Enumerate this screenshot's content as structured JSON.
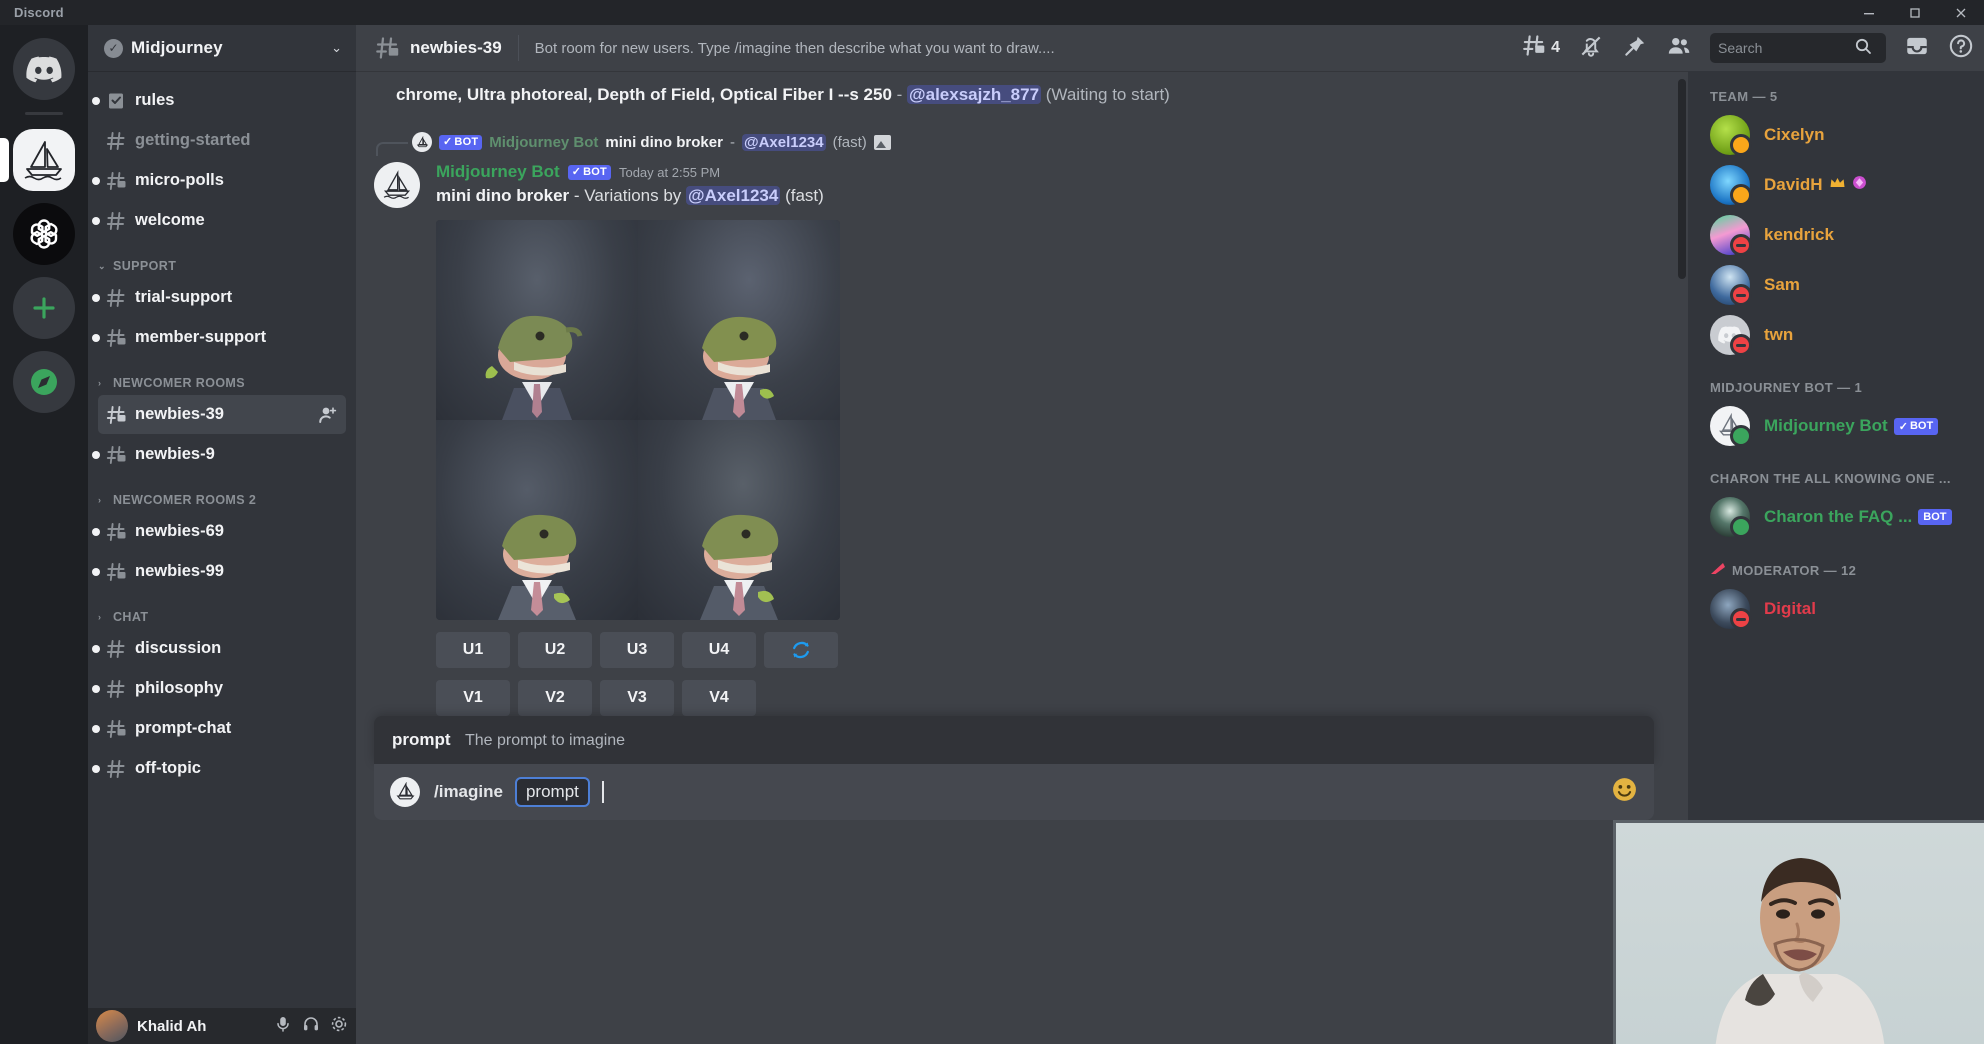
{
  "titlebar": {
    "app_name": "Discord",
    "minimize": "minimize-icon",
    "maximize": "maximize-icon",
    "close": "close-icon"
  },
  "server_rail": {
    "items": [
      {
        "name": "Direct Messages",
        "icon": "discord-logo-icon",
        "selected": false
      },
      {
        "name": "Midjourney",
        "icon": "sailboat-icon",
        "selected": true
      },
      {
        "name": "OpenAI",
        "icon": "openai-logo-icon",
        "selected": false
      },
      {
        "name": "Add a Server",
        "icon": "plus-icon",
        "selected": false
      },
      {
        "name": "Explore Public Servers",
        "icon": "compass-icon",
        "selected": false
      }
    ]
  },
  "sidebar": {
    "guild_name": "Midjourney",
    "verified_badge": "✓",
    "chevron": "⌄",
    "groups": [
      {
        "label": "",
        "channels": [
          {
            "name": "rules",
            "icon": "rules-icon",
            "muted": false,
            "unread": true,
            "active": false
          },
          {
            "name": "getting-started",
            "icon": "hash-icon",
            "muted": true,
            "unread": false,
            "active": false
          },
          {
            "name": "micro-polls",
            "icon": "hash-thread-icon",
            "muted": false,
            "unread": true,
            "active": false
          },
          {
            "name": "welcome",
            "icon": "hash-icon",
            "muted": false,
            "unread": true,
            "active": false
          }
        ]
      },
      {
        "label": "SUPPORT",
        "caret": "⌄",
        "channels": [
          {
            "name": "trial-support",
            "icon": "hash-icon",
            "muted": false,
            "unread": true,
            "active": false
          },
          {
            "name": "member-support",
            "icon": "hash-thread-icon",
            "muted": false,
            "unread": true,
            "active": false
          }
        ]
      },
      {
        "label": "NEWCOMER ROOMS",
        "caret": "›",
        "channels": [
          {
            "name": "newbies-39",
            "icon": "hash-thread-icon",
            "muted": false,
            "unread": false,
            "active": true,
            "trailing": "add-member-icon"
          },
          {
            "name": "newbies-9",
            "icon": "hash-thread-icon",
            "muted": false,
            "unread": true,
            "active": false
          }
        ]
      },
      {
        "label": "NEWCOMER ROOMS 2",
        "caret": "›",
        "channels": [
          {
            "name": "newbies-69",
            "icon": "hash-thread-icon",
            "muted": false,
            "unread": true,
            "active": false
          },
          {
            "name": "newbies-99",
            "icon": "hash-thread-icon",
            "muted": false,
            "unread": true,
            "active": false
          }
        ]
      },
      {
        "label": "CHAT",
        "caret": "›",
        "channels": [
          {
            "name": "discussion",
            "icon": "hash-icon",
            "muted": false,
            "unread": true,
            "active": false
          },
          {
            "name": "philosophy",
            "icon": "hash-icon",
            "muted": false,
            "unread": true,
            "active": false
          },
          {
            "name": "prompt-chat",
            "icon": "hash-thread-icon",
            "muted": false,
            "unread": true,
            "active": false
          },
          {
            "name": "off-topic",
            "icon": "hash-icon",
            "muted": false,
            "unread": true,
            "active": false
          }
        ]
      }
    ],
    "user_panel": {
      "username": "Khalid Ah"
    }
  },
  "channel_header": {
    "channel_name": "newbies-39",
    "topic": "Bot room for new users. Type /imagine then describe what you want to draw....",
    "threads_count": "4",
    "icons": [
      "threads-icon",
      "notification-muted-icon",
      "pinned-messages-icon",
      "member-list-icon",
      "inbox-icon",
      "help-icon"
    ]
  },
  "search": {
    "placeholder": "Search",
    "value": "",
    "icon": "search-icon"
  },
  "messages": {
    "partial": {
      "text_before": "chrome, Ultra photoreal, Depth of Field, Optical Fiber I --s 250",
      "separator": " - ",
      "mention": "@alexsajzh_877",
      "status": "(Waiting to start)"
    },
    "reply_reference": {
      "bot_badge": "BOT",
      "bot_badge_check": "✓",
      "author": "Midjourney Bot",
      "prompt": "mini dino broker",
      "separator": " - ",
      "mention": "@Axel1234",
      "speed": "(fast)",
      "attachment_icon": "image-attachment-icon"
    },
    "message": {
      "author": "Midjourney Bot",
      "bot_badge": "BOT",
      "bot_badge_check": "✓",
      "timestamp": "Today at 2:55 PM",
      "prompt": "mini dino broker",
      "action": " - Variations by ",
      "mention": "@Axel1234",
      "speed": "(fast)",
      "image_alt": "2x2 grid of dinosaur in a business suit"
    },
    "action_buttons": {
      "upscale": [
        "U1",
        "U2",
        "U3",
        "U4"
      ],
      "refresh_icon": "refresh-icon",
      "variation": [
        "V1",
        "V2",
        "V3",
        "V4"
      ]
    }
  },
  "composer": {
    "popup_arg": "prompt",
    "popup_desc": "The prompt to imagine",
    "command": "/imagine",
    "token": "prompt",
    "emoji_icon": "emoji-icon",
    "avatar": "midjourney-avatar-icon"
  },
  "member_list": {
    "groups": [
      {
        "label": "TEAM — 5",
        "members": [
          {
            "name": "Cixelyn",
            "color": "#e8a33d",
            "status": "idle",
            "badges": []
          },
          {
            "name": "DavidH",
            "color": "#e8a33d",
            "status": "idle",
            "badges": [
              "crown-icon",
              "gem-icon"
            ]
          },
          {
            "name": "kendrick",
            "color": "#e8a33d",
            "status": "dnd",
            "badges": []
          },
          {
            "name": "Sam",
            "color": "#e8a33d",
            "status": "dnd",
            "badges": []
          },
          {
            "name": "twn",
            "color": "#e8a33d",
            "status": "dnd",
            "badges": []
          }
        ]
      },
      {
        "label": "MIDJOURNEY BOT — 1",
        "members": [
          {
            "name": "Midjourney Bot",
            "color": "#3ba55d",
            "status": "online",
            "tag": "BOT",
            "tag_check": "✓",
            "badges": []
          }
        ]
      },
      {
        "label": "CHARON THE ALL KNOWING ONE ...",
        "members": [
          {
            "name": "Charon the FAQ ...",
            "color": "#3ba55d",
            "status": "online",
            "tag": "BOT",
            "badges": []
          }
        ]
      },
      {
        "label": "MODERATOR — 12",
        "icon": "moderator-icon",
        "members": [
          {
            "name": "Digital",
            "color": "#e23b4b",
            "status": "dnd",
            "badges": []
          }
        ]
      }
    ]
  },
  "webcam": {
    "label": "webcam-overlay"
  },
  "colors": {
    "accent_blurple": "#5865f2",
    "online_green": "#3ba55d",
    "idle_yellow": "#faa61a",
    "dnd_red": "#ed4245",
    "bg_main": "#3e4147",
    "bg_sidebar": "#32353b",
    "bg_rail": "#1e2024",
    "refresh_blue": "#1d9bf0"
  }
}
